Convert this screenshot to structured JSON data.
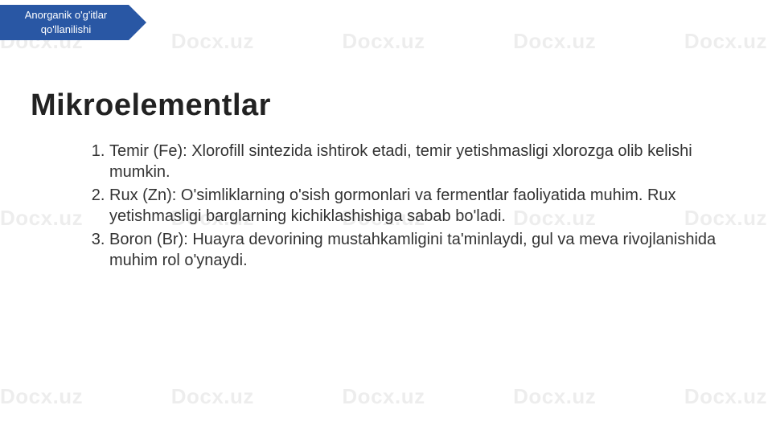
{
  "watermark": "Docx.uz",
  "ribbon": {
    "line1": "Anorganik o'g'itlar",
    "line2": "qo'llanilishi"
  },
  "title": "Mikroelementlar",
  "items": [
    {
      "lead": "Temir (Fe): ",
      "body": "Xlorofill sintezida ishtirok etadi, temir yetishmasligi xlorozga olib     kelishi mumkin."
    },
    {
      "lead": "Rux (Zn): ",
      "body": "O'simliklarning o'sish gormonlari va fermentlar faoliyatida muhim.                                                                                                              Rux yetishmasligi barglarning kichiklashishiga sabab bo'ladi."
    },
    {
      "lead": "Boron (Br): ",
      "body": "Huayra devorining mustahkamligini ta'minlaydi, gul va meva           rivojlanishida muhim rol o'ynaydi."
    }
  ]
}
